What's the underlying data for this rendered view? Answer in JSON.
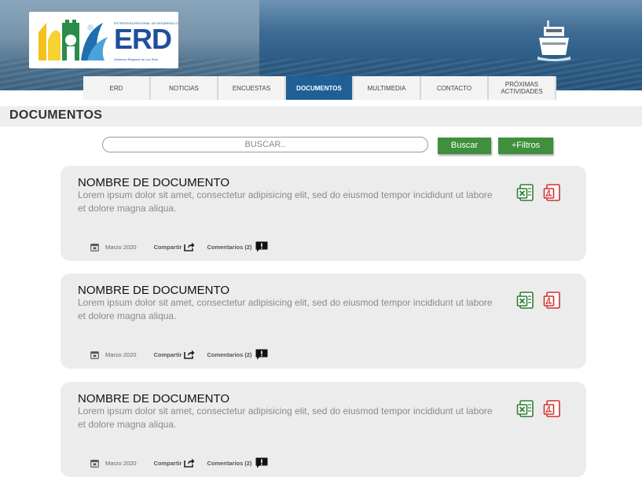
{
  "brand": {
    "small": "ESTRATEGIA REGIONAL DE DESARROLLO",
    "name": "ERD",
    "sub": "Gobierno Regional de Los Ríos"
  },
  "nav": [
    {
      "label": "ERD",
      "active": false
    },
    {
      "label": "NOTICIAS",
      "active": false
    },
    {
      "label": "ENCUESTAS",
      "active": false
    },
    {
      "label": "DOCUMENTOS",
      "active": true
    },
    {
      "label": "MULTIMEDIA",
      "active": false
    },
    {
      "label": "CONTACTO",
      "active": false
    },
    {
      "label": "PRÓXIMAS ACTIVIDADES",
      "active": false
    }
  ],
  "section_title": "DOCUMENTOS",
  "search": {
    "placeholder": "BUSCAR..",
    "button": "Buscar",
    "filters": "+Filtros"
  },
  "documents": [
    {
      "title": "NOMBRE DE DOCUMENTO",
      "description": "Lorem ipsum dolor sit amet, consectetur adipisicing elit, sed do eiusmod tempor incididunt ut labore et dolore magna aliqua.",
      "date": "Marzo 2020",
      "share": "Compartir",
      "comments": "Comentarios (2)"
    },
    {
      "title": "NOMBRE DE DOCUMENTO",
      "description": "Lorem ipsum dolor sit amet, consectetur adipisicing elit, sed do eiusmod tempor incididunt ut labore et dolore magna aliqua.",
      "date": "Marzo 2020",
      "share": "Compartir",
      "comments": "Comentarios (2)"
    },
    {
      "title": "NOMBRE DE DOCUMENTO",
      "description": "Lorem ipsum dolor sit amet, consectetur adipisicing elit, sed do eiusmod tempor incididunt ut labore et dolore magna aliqua.",
      "date": "Marzo 2020",
      "share": "Compartir",
      "comments": "Comentarios (2)"
    }
  ],
  "icons": {
    "excel": "excel-icon",
    "pdf": "pdf-icon",
    "calendar": "calendar-icon",
    "share": "share-icon",
    "comment": "comment-icon"
  },
  "colors": {
    "accent": "#1f5f95",
    "button": "#3f8f3c",
    "card": "#ececec"
  }
}
